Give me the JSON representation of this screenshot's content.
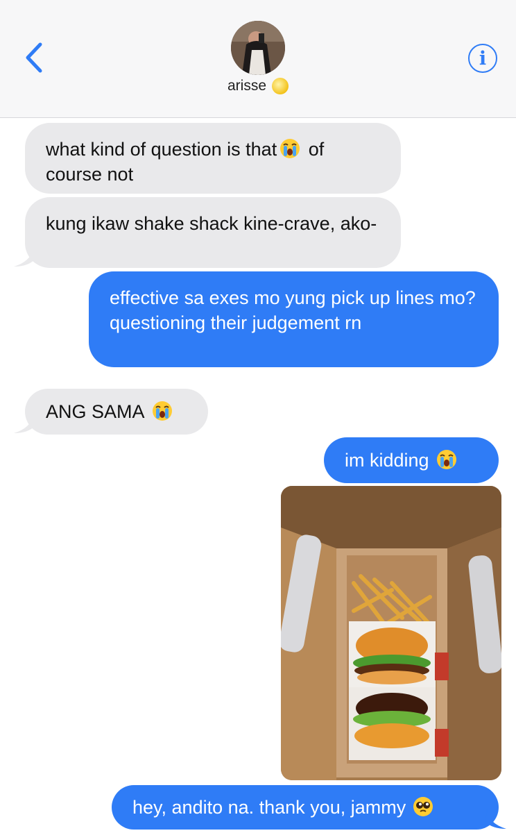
{
  "header": {
    "contact_name": "arisse",
    "back_icon": "chevron-left-icon",
    "info_icon": "info-icon",
    "info_glyph": "i",
    "status_icon": "moon-icon",
    "accent_color": "#2f7cf6"
  },
  "messages": [
    {
      "from": "them",
      "text_before": "what kind of question is that",
      "emoji": "loudly-crying-face",
      "text_after": " of course not"
    },
    {
      "from": "them",
      "text": "kung ikaw shake shack kine-crave, ako-"
    },
    {
      "from": "me",
      "text": "effective sa exes mo yung pick up lines mo? questioning their judgement rn"
    },
    {
      "from": "them",
      "text": "ANG SAMA",
      "emoji": "loudly-crying-face"
    },
    {
      "from": "me",
      "text": "im kidding",
      "emoji": "loudly-crying-face"
    },
    {
      "from": "me",
      "type": "photo",
      "alt": "burgers-and-fries-in-bag"
    },
    {
      "from": "me",
      "text": "hey, andito na. thank you, jammy",
      "emoji": "pleading-face"
    }
  ]
}
